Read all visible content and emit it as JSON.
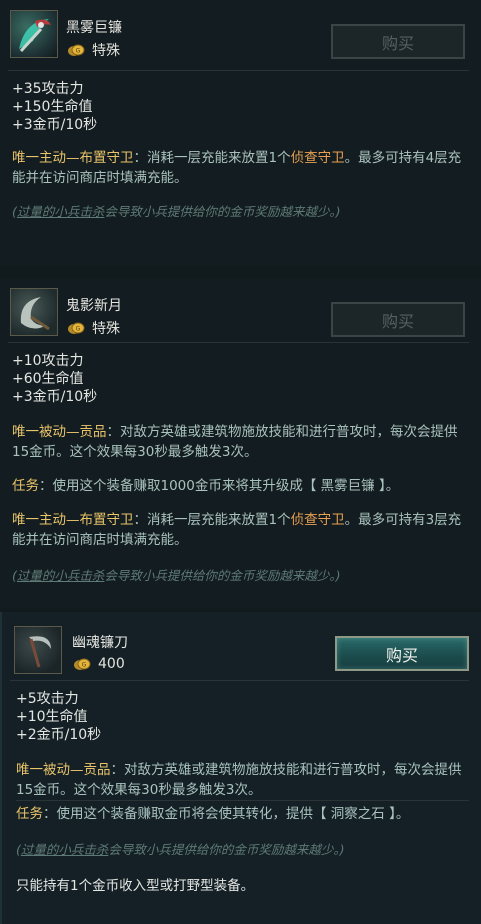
{
  "items": [
    {
      "name": "黑雾巨镰",
      "price": "特殊",
      "buy_label": "购买",
      "stats": [
        "+35攻击力",
        "+150生命值",
        "+3金币/10秒"
      ],
      "active_title": "唯一主动—布置守卫",
      "active_text_a": "：消耗一层充能来放置1个",
      "active_kw": "侦查守卫",
      "active_text_b": "。最多可持有4层充能并在访问商店时填满充能。",
      "note_pre": "(",
      "note_link": "过量的小兵击杀",
      "note_post": "会导致小兵提供给你的金币奖励越来越少。)"
    },
    {
      "name": "鬼影新月",
      "price": "特殊",
      "buy_label": "购买",
      "stats": [
        "+10攻击力",
        "+60生命值",
        "+3金币/10秒"
      ],
      "passive_title": "唯一被动—贡品",
      "passive_text": "：对敌方英雄或建筑物施放技能和进行普攻时，每次会提供15金币。这个效果每30秒最多触发3次。",
      "quest_title": "任务",
      "quest_text": "：使用这个装备赚取1000金币来将其升级成【 黑雾巨镰 】。",
      "active_title": "唯一主动—布置守卫",
      "active_text_a": "：消耗一层充能来放置1个",
      "active_kw": "侦查守卫",
      "active_text_b": "。最多可持有3层充能并在访问商店时填满充能。",
      "note_pre": "(",
      "note_link": "过量的小兵击杀",
      "note_post": "会导致小兵提供给你的金币奖励越来越少。)"
    },
    {
      "name": "幽魂镰刀",
      "price": "400",
      "buy_label": "购买",
      "stats": [
        "+5攻击力",
        "+10生命值",
        "+2金币/10秒"
      ],
      "passive_title": "唯一被动—贡品",
      "passive_text": "：对敌方英雄或建筑物施放技能和进行普攻时，每次会提供15金币。这个效果每30秒最多触发3次。",
      "quest_title": "任务",
      "quest_text": "：使用这个装备赚取金币将会使其转化，提供【 洞察之石 】。",
      "note_pre": "(",
      "note_link": "过量的小兵击杀",
      "note_post": "会导致小兵提供给你的金币奖励越来越少。)",
      "limit_text": "只能持有1个金币收入型或打野型装备。"
    }
  ],
  "colors": {
    "background": "#111a1d",
    "keyword_gold": "#e9c46a",
    "keyword_orange": "#e9a050",
    "body_text": "#a9c2bd",
    "buy_active": "#1c4d4e"
  },
  "icons": [
    "scythe-icon",
    "crescent-blade-icon",
    "sickle-icon",
    "gold-coin-icon"
  ]
}
